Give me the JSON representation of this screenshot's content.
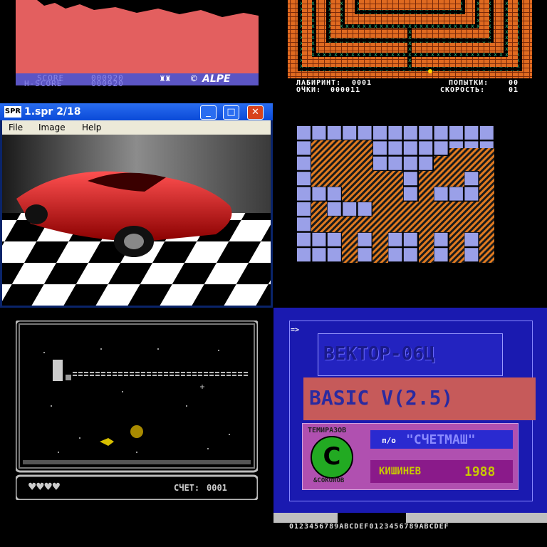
{
  "tile1": {
    "score_label": "SCORE",
    "score_value": "000920",
    "hscore_label": "H-SCORE",
    "hscore_value": "000920",
    "copyright": "©",
    "logo_text": "ALPE"
  },
  "tile2": {
    "maze_label": "ЛАБИРИНТ:",
    "maze_value": "0001",
    "tries_label": "ПОПЫТКИ:",
    "tries_value": "00",
    "points_label": "ОЧКИ:",
    "points_value": "000011",
    "speed_label": "СКОРОСТЬ:",
    "speed_value": "01"
  },
  "tile3": {
    "app_icon_text": "SPR",
    "title": "1.spr   2/18",
    "menu": [
      "File",
      "Image",
      "Help"
    ],
    "minimize": "_",
    "maximize": "□",
    "close": "✕"
  },
  "tile5": {
    "score_label": "СЧЕТ:",
    "score_value": "0001"
  },
  "tile6": {
    "prompt": "=>",
    "title": "ВЕКТОР-06Ц",
    "basic": "BASIC V(2.5)",
    "author_top": "ТЕМИРАЗОВ",
    "author_bottom": "&СОКОЛОВ",
    "badge_letter": "С",
    "po": "п/о",
    "company": "\"СЧЕТМАШ\"",
    "city": "КИШИНЕВ",
    "year": "1988",
    "charset": "0123456789ABCDEF0123456789ABCDEF"
  },
  "colors": {
    "game_red": "#e35f5f",
    "c64_blue": "#5b55c4",
    "brick": "#e06a20",
    "xp_blue": "#0a4ad8",
    "vector_blue": "#1a1ab0"
  }
}
